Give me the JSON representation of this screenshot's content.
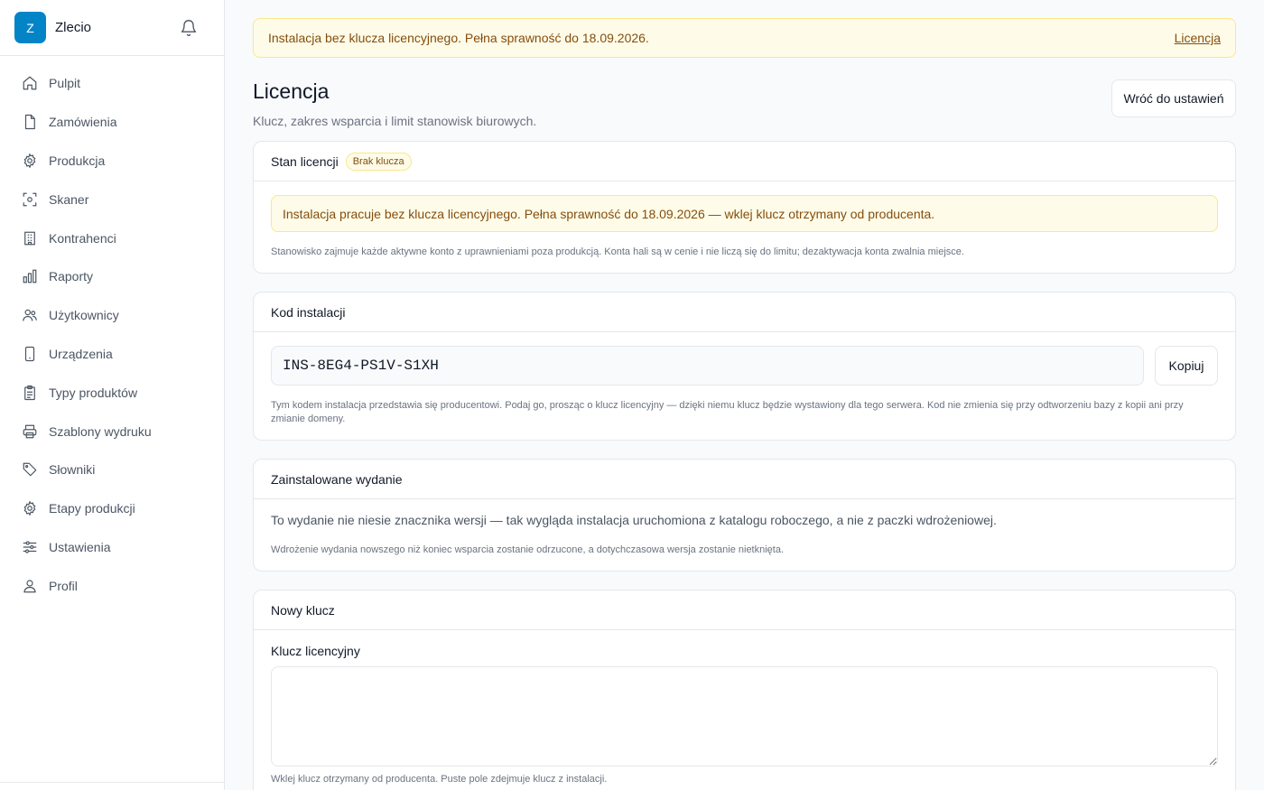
{
  "app": {
    "logo_letter": "Z",
    "name": "Zlecio"
  },
  "sidebar": {
    "items": [
      {
        "label": "Pulpit",
        "icon": "home-icon"
      },
      {
        "label": "Zamówienia",
        "icon": "document-icon"
      },
      {
        "label": "Produkcja",
        "icon": "gear-icon"
      },
      {
        "label": "Skaner",
        "icon": "scan-icon"
      },
      {
        "label": "Kontrahenci",
        "icon": "building-icon"
      },
      {
        "label": "Raporty",
        "icon": "bar-chart-icon"
      },
      {
        "label": "Użytkownicy",
        "icon": "users-icon"
      },
      {
        "label": "Urządzenia",
        "icon": "phone-icon"
      },
      {
        "label": "Typy produktów",
        "icon": "clipboard-icon"
      },
      {
        "label": "Szablony wydruku",
        "icon": "printer-icon"
      },
      {
        "label": "Słowniki",
        "icon": "tag-icon"
      },
      {
        "label": "Etapy produkcji",
        "icon": "gear-icon"
      },
      {
        "label": "Ustawienia",
        "icon": "sliders-icon"
      },
      {
        "label": "Profil",
        "icon": "user-icon"
      }
    ]
  },
  "banner": {
    "text": "Instalacja bez klucza licencyjnego. Pełna sprawność do 18.09.2026.",
    "link": "Licencja"
  },
  "page": {
    "title": "Licencja",
    "subtitle": "Klucz, zakres wsparcia i limit stanowisk biurowych.",
    "back_button": "Wróć do ustawień"
  },
  "license_state": {
    "title": "Stan licencji",
    "badge": "Brak klucza",
    "warning": "Instalacja pracuje bez klucza licencyjnego. Pełna sprawność do 18.09.2026 — wklej klucz otrzymany od producenta.",
    "note": "Stanowisko zajmuje każde aktywne konto z uprawnieniami poza produkcją. Konta hali są w cenie i nie liczą się do limitu; dezaktywacja konta zwalnia miejsce."
  },
  "install_code": {
    "title": "Kod instalacji",
    "code": "INS-8EG4-PS1V-S1XH",
    "copy_button": "Kopiuj",
    "note": "Tym kodem instalacja przedstawia się producentowi. Podaj go, prosząc o klucz licencyjny — dzięki niemu klucz będzie wystawiony dla tego serwera. Kod nie zmienia się przy odtworzeniu bazy z kopii ani przy zmianie domeny."
  },
  "installed_release": {
    "title": "Zainstalowane wydanie",
    "text": "To wydanie nie niesie znacznika wersji — tak wygląda instalacja uruchomiona z katalogu roboczego, a nie z paczki wdrożeniowej.",
    "note": "Wdrożenie wydania nowszego niż koniec wsparcia zostanie odrzucone, a dotychczasowa wersja zostanie nietknięta."
  },
  "new_key": {
    "title": "Nowy klucz",
    "field_label": "Klucz licencyjny",
    "value": "",
    "hint": "Wklej klucz otrzymany od producenta. Puste pole zdejmuje klucz z instalacji."
  },
  "colors": {
    "accent": "#0284c7",
    "warning_bg": "#fefce8",
    "warning_border": "#fde68a",
    "warning_text": "#854d0e"
  }
}
